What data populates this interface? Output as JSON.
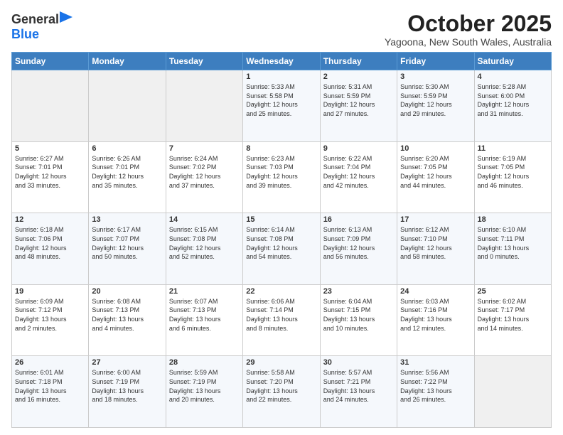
{
  "logo": {
    "general": "General",
    "blue": "Blue"
  },
  "header": {
    "month_title": "October 2025",
    "subtitle": "Yagoona, New South Wales, Australia"
  },
  "weekdays": [
    "Sunday",
    "Monday",
    "Tuesday",
    "Wednesday",
    "Thursday",
    "Friday",
    "Saturday"
  ],
  "weeks": [
    [
      {
        "day": "",
        "content": ""
      },
      {
        "day": "",
        "content": ""
      },
      {
        "day": "",
        "content": ""
      },
      {
        "day": "1",
        "content": "Sunrise: 5:33 AM\nSunset: 5:58 PM\nDaylight: 12 hours\nand 25 minutes."
      },
      {
        "day": "2",
        "content": "Sunrise: 5:31 AM\nSunset: 5:59 PM\nDaylight: 12 hours\nand 27 minutes."
      },
      {
        "day": "3",
        "content": "Sunrise: 5:30 AM\nSunset: 5:59 PM\nDaylight: 12 hours\nand 29 minutes."
      },
      {
        "day": "4",
        "content": "Sunrise: 5:28 AM\nSunset: 6:00 PM\nDaylight: 12 hours\nand 31 minutes."
      }
    ],
    [
      {
        "day": "5",
        "content": "Sunrise: 6:27 AM\nSunset: 7:01 PM\nDaylight: 12 hours\nand 33 minutes."
      },
      {
        "day": "6",
        "content": "Sunrise: 6:26 AM\nSunset: 7:01 PM\nDaylight: 12 hours\nand 35 minutes."
      },
      {
        "day": "7",
        "content": "Sunrise: 6:24 AM\nSunset: 7:02 PM\nDaylight: 12 hours\nand 37 minutes."
      },
      {
        "day": "8",
        "content": "Sunrise: 6:23 AM\nSunset: 7:03 PM\nDaylight: 12 hours\nand 39 minutes."
      },
      {
        "day": "9",
        "content": "Sunrise: 6:22 AM\nSunset: 7:04 PM\nDaylight: 12 hours\nand 42 minutes."
      },
      {
        "day": "10",
        "content": "Sunrise: 6:20 AM\nSunset: 7:05 PM\nDaylight: 12 hours\nand 44 minutes."
      },
      {
        "day": "11",
        "content": "Sunrise: 6:19 AM\nSunset: 7:05 PM\nDaylight: 12 hours\nand 46 minutes."
      }
    ],
    [
      {
        "day": "12",
        "content": "Sunrise: 6:18 AM\nSunset: 7:06 PM\nDaylight: 12 hours\nand 48 minutes."
      },
      {
        "day": "13",
        "content": "Sunrise: 6:17 AM\nSunset: 7:07 PM\nDaylight: 12 hours\nand 50 minutes."
      },
      {
        "day": "14",
        "content": "Sunrise: 6:15 AM\nSunset: 7:08 PM\nDaylight: 12 hours\nand 52 minutes."
      },
      {
        "day": "15",
        "content": "Sunrise: 6:14 AM\nSunset: 7:08 PM\nDaylight: 12 hours\nand 54 minutes."
      },
      {
        "day": "16",
        "content": "Sunrise: 6:13 AM\nSunset: 7:09 PM\nDaylight: 12 hours\nand 56 minutes."
      },
      {
        "day": "17",
        "content": "Sunrise: 6:12 AM\nSunset: 7:10 PM\nDaylight: 12 hours\nand 58 minutes."
      },
      {
        "day": "18",
        "content": "Sunrise: 6:10 AM\nSunset: 7:11 PM\nDaylight: 13 hours\nand 0 minutes."
      }
    ],
    [
      {
        "day": "19",
        "content": "Sunrise: 6:09 AM\nSunset: 7:12 PM\nDaylight: 13 hours\nand 2 minutes."
      },
      {
        "day": "20",
        "content": "Sunrise: 6:08 AM\nSunset: 7:13 PM\nDaylight: 13 hours\nand 4 minutes."
      },
      {
        "day": "21",
        "content": "Sunrise: 6:07 AM\nSunset: 7:13 PM\nDaylight: 13 hours\nand 6 minutes."
      },
      {
        "day": "22",
        "content": "Sunrise: 6:06 AM\nSunset: 7:14 PM\nDaylight: 13 hours\nand 8 minutes."
      },
      {
        "day": "23",
        "content": "Sunrise: 6:04 AM\nSunset: 7:15 PM\nDaylight: 13 hours\nand 10 minutes."
      },
      {
        "day": "24",
        "content": "Sunrise: 6:03 AM\nSunset: 7:16 PM\nDaylight: 13 hours\nand 12 minutes."
      },
      {
        "day": "25",
        "content": "Sunrise: 6:02 AM\nSunset: 7:17 PM\nDaylight: 13 hours\nand 14 minutes."
      }
    ],
    [
      {
        "day": "26",
        "content": "Sunrise: 6:01 AM\nSunset: 7:18 PM\nDaylight: 13 hours\nand 16 minutes."
      },
      {
        "day": "27",
        "content": "Sunrise: 6:00 AM\nSunset: 7:19 PM\nDaylight: 13 hours\nand 18 minutes."
      },
      {
        "day": "28",
        "content": "Sunrise: 5:59 AM\nSunset: 7:19 PM\nDaylight: 13 hours\nand 20 minutes."
      },
      {
        "day": "29",
        "content": "Sunrise: 5:58 AM\nSunset: 7:20 PM\nDaylight: 13 hours\nand 22 minutes."
      },
      {
        "day": "30",
        "content": "Sunrise: 5:57 AM\nSunset: 7:21 PM\nDaylight: 13 hours\nand 24 minutes."
      },
      {
        "day": "31",
        "content": "Sunrise: 5:56 AM\nSunset: 7:22 PM\nDaylight: 13 hours\nand 26 minutes."
      },
      {
        "day": "",
        "content": ""
      }
    ]
  ]
}
